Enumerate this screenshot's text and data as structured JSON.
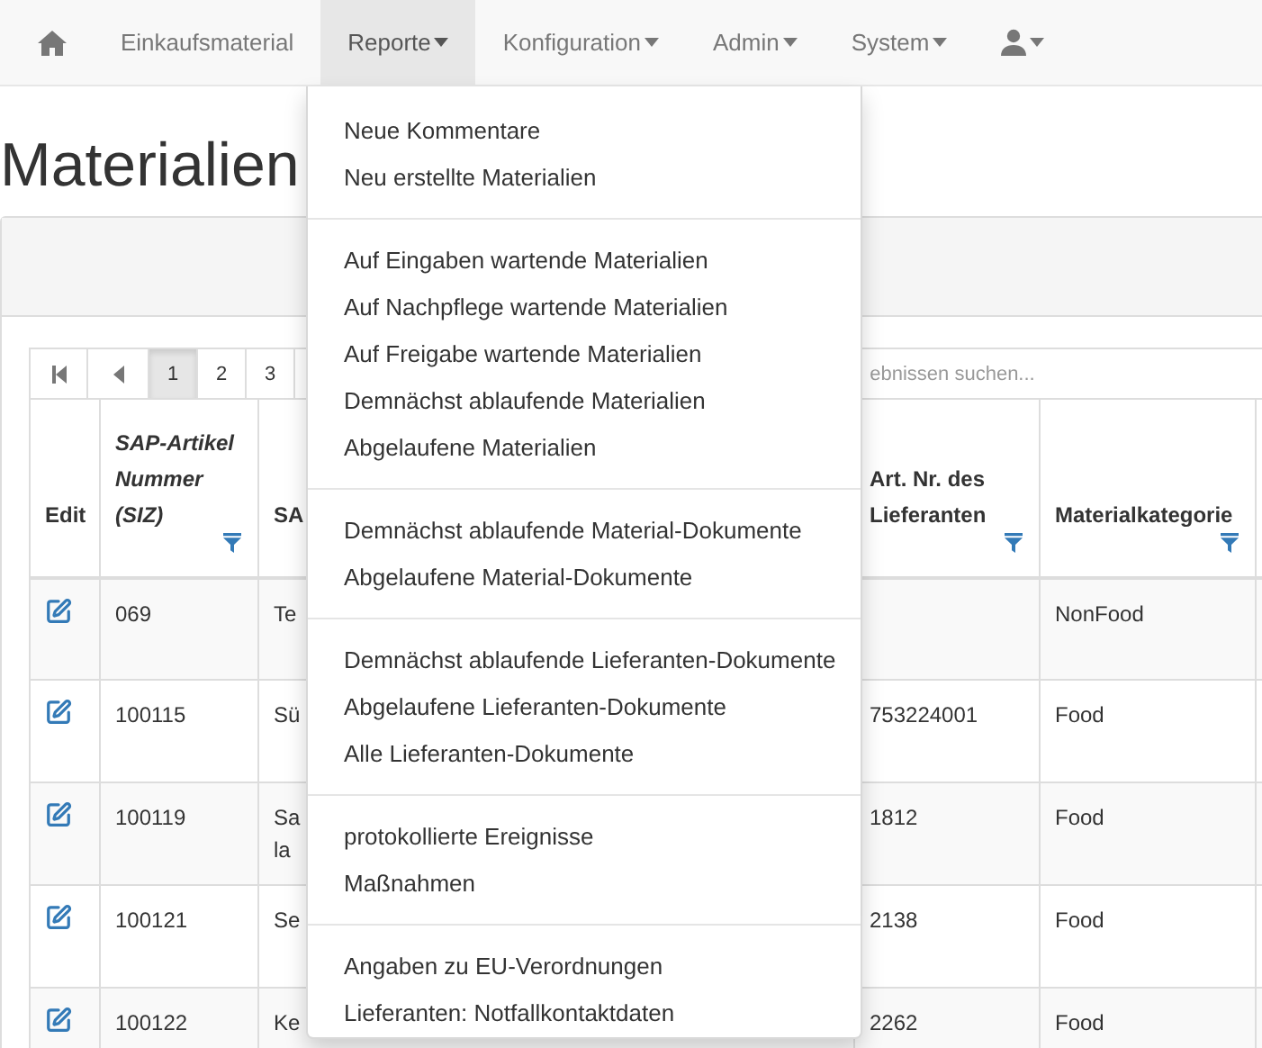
{
  "nav": {
    "items": [
      {
        "kind": "home",
        "selected": false
      },
      {
        "kind": "link",
        "label": "Einkaufsmaterial",
        "selected": false
      },
      {
        "kind": "dropdown",
        "label": "Reporte",
        "selected": true
      },
      {
        "kind": "dropdown",
        "label": "Konfiguration",
        "selected": false
      },
      {
        "kind": "dropdown",
        "label": "Admin",
        "selected": false
      },
      {
        "kind": "dropdown",
        "label": "System",
        "selected": false
      },
      {
        "kind": "user",
        "selected": false
      }
    ]
  },
  "menu": {
    "groups": [
      [
        "Neue Kommentare",
        "Neu erstellte Materialien"
      ],
      [
        "Auf Eingaben wartende Materialien",
        "Auf Nachpflege wartende Materialien",
        "Auf Freigabe wartende Materialien",
        "Demnächst ablaufende Materialien",
        "Abgelaufene Materialien"
      ],
      [
        "Demnächst ablaufende Material-Dokumente",
        "Abgelaufene Material-Dokumente"
      ],
      [
        "Demnächst ablaufende Lieferanten-Dokumente",
        "Abgelaufene Lieferanten-Dokumente",
        "Alle Lieferanten-Dokumente"
      ],
      [
        "protokollierte Ereignisse",
        "Maßnahmen"
      ],
      [
        "Angaben zu EU-Verordnungen",
        "Lieferanten: Notfallkontaktdaten"
      ]
    ]
  },
  "page_title": "Materialien",
  "pager": {
    "buttons": [
      {
        "kind": "first",
        "selected": false
      },
      {
        "kind": "prev",
        "selected": false
      },
      {
        "kind": "page",
        "label": "1",
        "selected": true
      },
      {
        "kind": "page",
        "label": "2",
        "selected": false
      },
      {
        "kind": "page",
        "label": "3",
        "selected": false
      }
    ]
  },
  "search": {
    "placeholder": "ebnissen suchen..."
  },
  "table": {
    "columns": [
      {
        "label": "Edit",
        "italic": false,
        "filter": false
      },
      {
        "label": "SAP-Artikel Nummer (SIZ)",
        "italic": true,
        "filter": true
      },
      {
        "label": "SA",
        "italic": false
      },
      {
        "label": "Art. Nr. des Lieferanten",
        "italic": false,
        "filter": true
      },
      {
        "label": "Materialkategorie",
        "italic": false,
        "filter": true
      }
    ],
    "rows": [
      {
        "cells": [
          "",
          "069",
          "Te",
          "",
          "NonFood"
        ]
      },
      {
        "cells": [
          "",
          "100115",
          "Sü",
          "753224001",
          "Food"
        ]
      },
      {
        "cells": [
          "",
          "100119",
          "Sa\nla",
          "1812",
          "Food"
        ]
      },
      {
        "cells": [
          "",
          "100121",
          "Se",
          "2138",
          "Food"
        ]
      },
      {
        "cells": [
          "",
          "100122",
          "Ke",
          "2262",
          "Food"
        ]
      }
    ]
  }
}
